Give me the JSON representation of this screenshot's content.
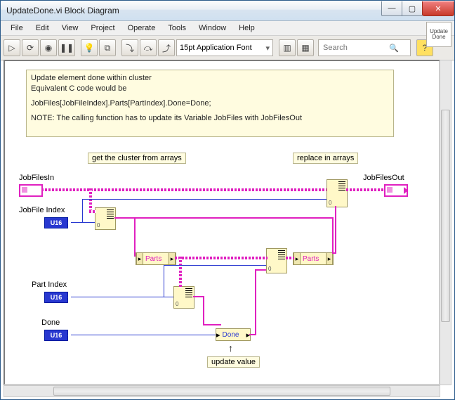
{
  "window": {
    "title": "UpdateDone.vi Block Diagram"
  },
  "menu": {
    "file": "File",
    "edit": "Edit",
    "view": "View",
    "project": "Project",
    "operate": "Operate",
    "tools": "Tools",
    "window": "Window",
    "help": "Help"
  },
  "toolbar": {
    "font": "15pt Application Font",
    "search_placeholder": "Search"
  },
  "vi_icon": {
    "l1": "Update",
    "l2": "Done"
  },
  "comment": {
    "l1": "Update element done within cluster",
    "l2": "Equivalent C code would be",
    "l3": "JobFiles[JobFileIndex].Parts[PartIndex].Done=Done;",
    "l4": "NOTE: The calling function has to update its Variable JobFiles with JobFilesOut"
  },
  "labels": {
    "get_cluster": "get the cluster from arrays",
    "replace": "replace in arrays",
    "update_value": "update value"
  },
  "controls": {
    "jobfiles_in": "JobFilesIn",
    "jobfile_index": "JobFile Index",
    "part_index": "Part Index",
    "done": "Done",
    "jobfiles_out": "JobFilesOut"
  },
  "datatype": {
    "u16": "U16"
  },
  "bundle": {
    "parts": "Parts",
    "done": "Done"
  },
  "chart_data": {
    "type": "diagram",
    "nodes": [
      {
        "id": "JobFilesIn",
        "kind": "control-array"
      },
      {
        "id": "JobFileIndex",
        "kind": "control-u16"
      },
      {
        "id": "PartIndex",
        "kind": "control-u16"
      },
      {
        "id": "Done",
        "kind": "control-u16"
      },
      {
        "id": "IndexArray1",
        "kind": "index-array"
      },
      {
        "id": "UnbundleParts",
        "kind": "unbundle-by-name",
        "field": "Parts"
      },
      {
        "id": "IndexArray2",
        "kind": "index-array"
      },
      {
        "id": "BundleDone",
        "kind": "bundle-by-name",
        "field": "Done"
      },
      {
        "id": "ReplaceArray2",
        "kind": "replace-array-subset"
      },
      {
        "id": "BundleParts",
        "kind": "bundle-by-name",
        "field": "Parts"
      },
      {
        "id": "ReplaceArray1",
        "kind": "replace-array-subset"
      },
      {
        "id": "JobFilesOut",
        "kind": "indicator-array"
      }
    ],
    "edges": [
      [
        "JobFilesIn",
        "IndexArray1"
      ],
      [
        "JobFilesIn",
        "ReplaceArray1"
      ],
      [
        "JobFileIndex",
        "IndexArray1"
      ],
      [
        "JobFileIndex",
        "ReplaceArray1"
      ],
      [
        "IndexArray1",
        "UnbundleParts"
      ],
      [
        "IndexArray1",
        "BundleParts"
      ],
      [
        "UnbundleParts",
        "IndexArray2"
      ],
      [
        "UnbundleParts",
        "ReplaceArray2"
      ],
      [
        "PartIndex",
        "IndexArray2"
      ],
      [
        "PartIndex",
        "ReplaceArray2"
      ],
      [
        "IndexArray2",
        "BundleDone"
      ],
      [
        "Done",
        "BundleDone"
      ],
      [
        "BundleDone",
        "ReplaceArray2"
      ],
      [
        "ReplaceArray2",
        "BundleParts"
      ],
      [
        "BundleParts",
        "ReplaceArray1"
      ],
      [
        "ReplaceArray1",
        "JobFilesOut"
      ]
    ]
  }
}
